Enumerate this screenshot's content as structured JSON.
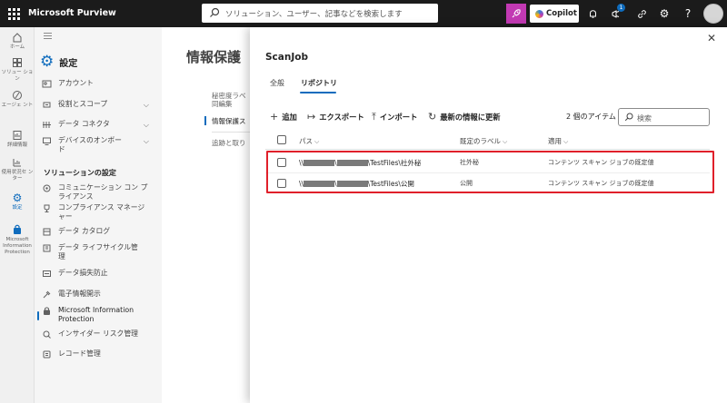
{
  "header": {
    "app_title": "Microsoft Purview",
    "search_placeholder": "ソリューション、ユーザー、記事などを検索します",
    "copilot_label": "Copilot",
    "notification_badge": "1"
  },
  "leftnav": [
    {
      "icon": "home-icon",
      "label": "ホーム"
    },
    {
      "icon": "solutions-icon",
      "label": "ソリュー ション"
    },
    {
      "icon": "agents-icon",
      "label": "エージェ ント"
    },
    {
      "icon": "learn-icon",
      "label": "詳細情報"
    },
    {
      "icon": "usage-center-icon",
      "label": "使用状況セ ンター"
    },
    {
      "icon": "settings-icon",
      "label": "設定"
    },
    {
      "icon": "information-protection-icon",
      "label": "Microsoft Information Protection"
    }
  ],
  "sidebar": {
    "title": "設定",
    "items_top": [
      {
        "icon": "account-icon",
        "label": "アカウント",
        "chevron": false
      },
      {
        "icon": "roles-icon",
        "label": "役割とスコープ",
        "chevron": true
      },
      {
        "icon": "connector-icon",
        "label": "データ コネクタ",
        "chevron": true
      },
      {
        "icon": "device-icon",
        "label": "デバイスのオンボー ド",
        "chevron": true
      }
    ],
    "section_title": "ソリューションの設定",
    "items_bottom": [
      {
        "icon": "communication-compliance-icon",
        "label": "コミュニケーション コン プライアンス"
      },
      {
        "icon": "compliance-manager-icon",
        "label": "コンプライアンス マネージ ャー"
      },
      {
        "icon": "data-catalog-icon",
        "label": "データ カタログ"
      },
      {
        "icon": "lifecycle-icon",
        "label": "データ ライフサイクル管 理"
      },
      {
        "icon": "dlp-icon",
        "label": "データ損失防止"
      },
      {
        "icon": "ediscovery-icon",
        "label": "電子情報開示"
      },
      {
        "icon": "mip-icon",
        "label": "Microsoft Information Protection"
      },
      {
        "icon": "insider-risk-icon",
        "label": "インサイダー リスク管理"
      },
      {
        "icon": "records-icon",
        "label": "レコード管理"
      }
    ]
  },
  "main": {
    "title": "情報保護",
    "items": [
      "秘密度ラベ",
      "同編集",
      "情報保護ス",
      "追跡と取り"
    ]
  },
  "panel": {
    "title": "ScanJob",
    "tabs": [
      "全般",
      "リポジトリ"
    ],
    "active_tab": "リポジトリ",
    "commands": [
      {
        "icon": "plus-icon",
        "glyph": "+",
        "label": "追加"
      },
      {
        "icon": "export-icon",
        "glyph": "↦",
        "label": "エクスポート"
      },
      {
        "icon": "import-icon",
        "glyph": "⤒",
        "label": "インポート"
      },
      {
        "icon": "refresh-icon",
        "glyph": "↻",
        "label": "最新の情報に更新"
      }
    ],
    "item_count": "2 個のアイテム",
    "search_placeholder": "検索",
    "columns": [
      "パス",
      "既定のラベル",
      "適用"
    ],
    "rows": [
      {
        "path_prefix": "\\\\",
        "path_suffix": "\\TestFiles\\社外秘",
        "label": "社外秘",
        "rule": "コンテンツ スキャン ジョブの既定値"
      },
      {
        "path_prefix": "\\\\",
        "path_suffix": "\\TestFiles\\公開",
        "label": "公開",
        "rule": "コンテンツ スキャン ジョブの既定値"
      }
    ]
  },
  "colors": {
    "topbar": "#1b1b1b",
    "accent": "#0f6cbd",
    "coach": "#c239b3",
    "highlight": "#e0202a"
  }
}
